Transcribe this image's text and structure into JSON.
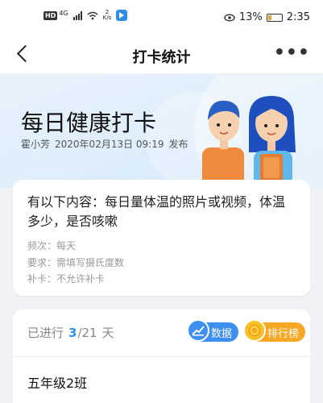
{
  "status_bar": {
    "network": "HD",
    "network_gen": "4G",
    "speed_value": "2",
    "speed_unit": "K/s",
    "battery_percent": "13%",
    "time": "2:35"
  },
  "nav": {
    "title": "打卡统计"
  },
  "hero": {
    "title": "每日健康打卡",
    "author": "霍小芳",
    "datetime": "2020年02月13日 09:19",
    "action": "发布"
  },
  "detail": {
    "description": "有以下内容：每日量体温的照片或视频，体温多少，是否咳嗽",
    "rules": [
      {
        "label": "频次：每天"
      },
      {
        "label": "要求：需填写摄氏度数"
      },
      {
        "label": "补卡：不允许补卡"
      }
    ]
  },
  "stats": {
    "progress_prefix": "已进行",
    "current": "3",
    "total": "/21",
    "unit": "天",
    "data_button": "数据",
    "rank_button": "排行榜",
    "class_name": "五年级2班"
  },
  "colors": {
    "accent": "#2f8de4",
    "rank": "#f6a723",
    "battery": "#e8a13a"
  }
}
